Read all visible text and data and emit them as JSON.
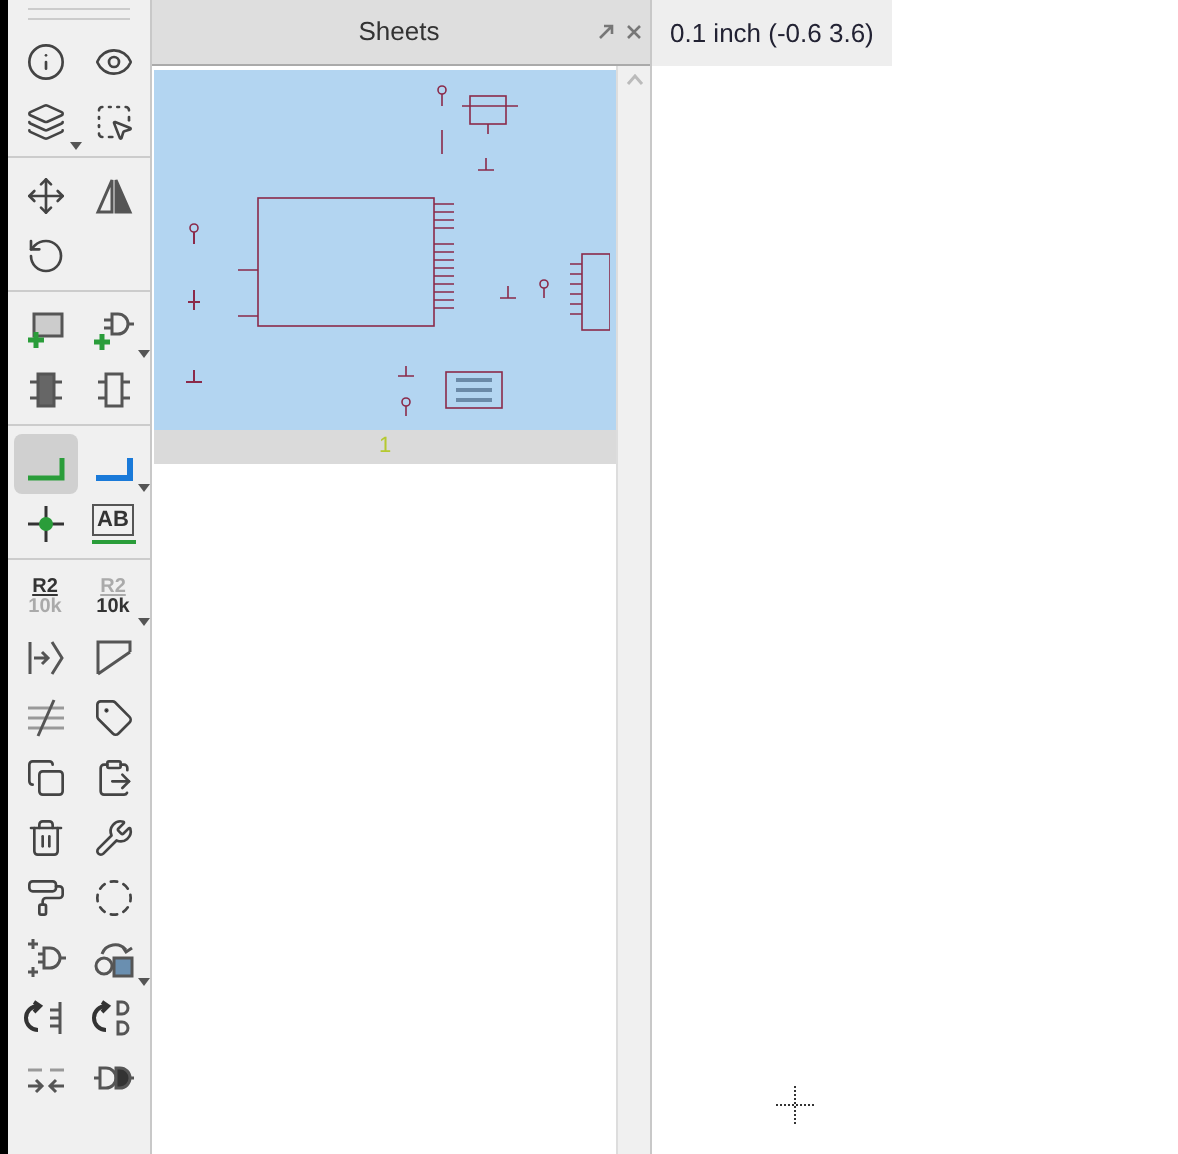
{
  "toolbar": {
    "groups": [
      {
        "items": [
          {
            "kind": "info",
            "selected": false
          },
          {
            "kind": "eye",
            "selected": false
          },
          {
            "kind": "layers",
            "selected": false,
            "menu": true
          },
          {
            "kind": "select",
            "selected": false
          }
        ]
      },
      {
        "items": [
          {
            "kind": "move",
            "selected": false
          },
          {
            "kind": "mirror",
            "selected": false
          },
          {
            "kind": "rotate",
            "selected": false
          }
        ]
      },
      {
        "items": [
          {
            "kind": "add-part",
            "selected": false
          },
          {
            "kind": "add-gate",
            "selected": false,
            "menu": true
          },
          {
            "kind": "chip-filled",
            "selected": false
          },
          {
            "kind": "chip-outline",
            "selected": false
          }
        ]
      },
      {
        "items": [
          {
            "kind": "wire",
            "selected": true
          },
          {
            "kind": "bus",
            "selected": false,
            "menu": true
          },
          {
            "kind": "junction",
            "selected": false
          },
          {
            "kind": "label",
            "selected": false,
            "text": "AB"
          }
        ]
      },
      {
        "items": [
          {
            "kind": "name",
            "selected": false,
            "top": "R2",
            "bottom": "10k"
          },
          {
            "kind": "value",
            "selected": false,
            "menu": true,
            "top": "R2",
            "bottom": "10k"
          },
          {
            "kind": "arrow-bracket",
            "selected": false
          },
          {
            "kind": "line",
            "selected": false
          },
          {
            "kind": "split",
            "selected": false
          },
          {
            "kind": "tag",
            "selected": false
          },
          {
            "kind": "copy",
            "selected": false
          },
          {
            "kind": "paste",
            "selected": false
          },
          {
            "kind": "delete",
            "selected": false
          },
          {
            "kind": "wrench",
            "selected": false
          },
          {
            "kind": "roller",
            "selected": false
          },
          {
            "kind": "dotted-circle",
            "selected": false
          },
          {
            "kind": "gate-plus",
            "selected": false
          },
          {
            "kind": "rotate-square",
            "selected": false,
            "menu": true
          },
          {
            "kind": "swap-pins",
            "selected": false
          },
          {
            "kind": "swap-gates",
            "selected": false
          },
          {
            "kind": "arrows-in",
            "selected": false
          },
          {
            "kind": "gate-plug",
            "selected": false
          }
        ]
      }
    ]
  },
  "sheets_panel": {
    "title": "Sheets",
    "sheets": [
      {
        "number": "1",
        "selected": true
      }
    ]
  },
  "status": {
    "grid": "0.1 inch (-0.6 3.6)"
  }
}
